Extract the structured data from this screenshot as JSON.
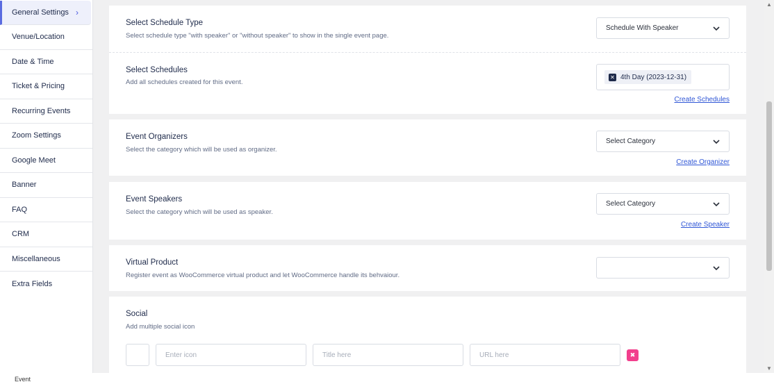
{
  "sidebar": {
    "items": [
      {
        "label": "General Settings"
      },
      {
        "label": "Venue/Location"
      },
      {
        "label": "Date & Time"
      },
      {
        "label": "Ticket & Pricing"
      },
      {
        "label": "Recurring Events"
      },
      {
        "label": "Zoom Settings"
      },
      {
        "label": "Google Meet"
      },
      {
        "label": "Banner"
      },
      {
        "label": "FAQ"
      },
      {
        "label": "CRM"
      },
      {
        "label": "Miscellaneous"
      },
      {
        "label": "Extra Fields"
      }
    ],
    "active_chevron": "›"
  },
  "schedule_type": {
    "title": "Select Schedule Type",
    "desc": "Select schedule type \"with speaker\" or \"without speaker\" to show in the single event page.",
    "selected": "Schedule With Speaker"
  },
  "schedules": {
    "title": "Select Schedules",
    "desc": "Add all schedules created for this event.",
    "tags": [
      {
        "label": "4th Day (2023-12-31)"
      }
    ],
    "link": "Create Schedules"
  },
  "organizers": {
    "title": "Event Organizers",
    "desc": "Select the category which will be used as organizer.",
    "selected": "Select Category",
    "link": "Create Organizer"
  },
  "speakers": {
    "title": "Event Speakers",
    "desc": "Select the category which will be used as speaker.",
    "selected": "Select Category",
    "link": "Create Speaker"
  },
  "virtual_product": {
    "title": "Virtual Product",
    "desc": "Register event as WooCommerce virtual product and let WooCommerce handle its behvaiour.",
    "selected": ""
  },
  "social": {
    "title": "Social",
    "desc": "Add multiple social icon",
    "icon_placeholder": "Enter icon",
    "title_placeholder": "Title here",
    "url_placeholder": "URL here",
    "delete_glyph": "✖"
  },
  "footer": {
    "label": "Event"
  },
  "colors": {
    "accent": "#5a6be0",
    "link": "#2f56d6",
    "delete": "#f23f8d"
  }
}
